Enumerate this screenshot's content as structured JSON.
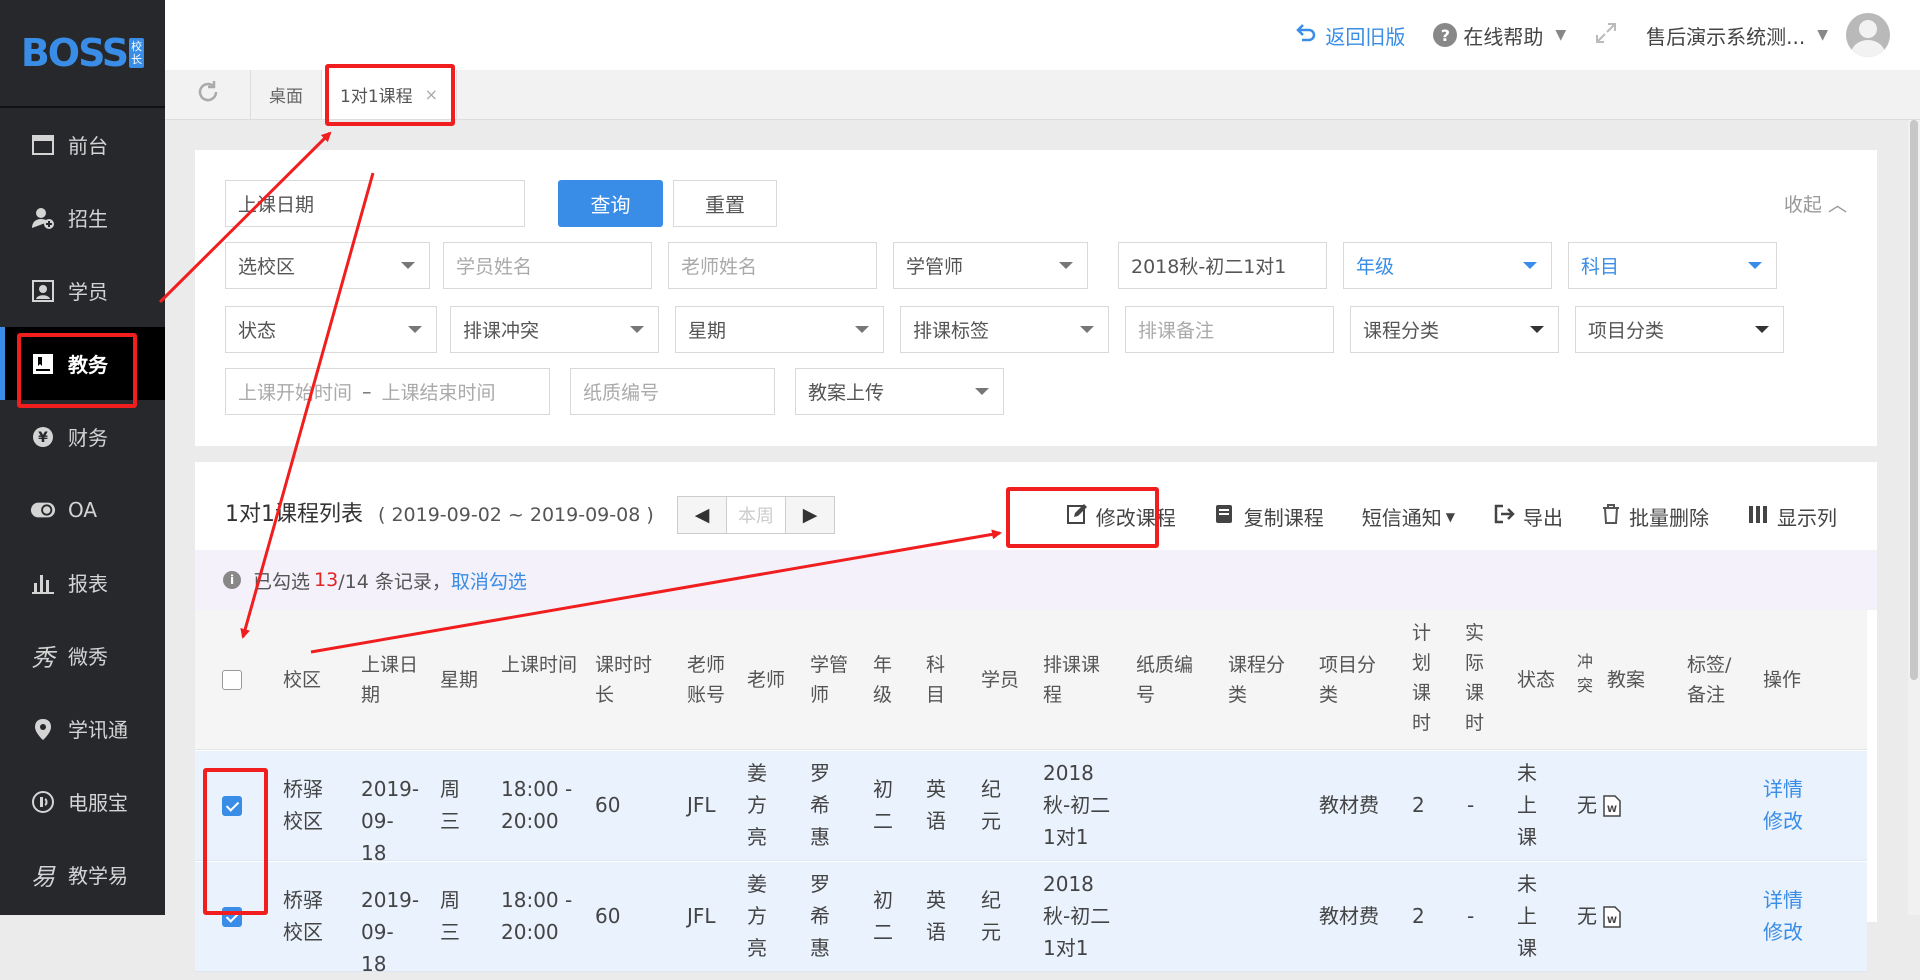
{
  "sidebar": {
    "logo_text": "BOSS",
    "logo_badge": "校长",
    "items": [
      {
        "label": "前台",
        "icon": "calendar-icon"
      },
      {
        "label": "招生",
        "icon": "add-user-icon"
      },
      {
        "label": "学员",
        "icon": "id-card-icon"
      },
      {
        "label": "教务",
        "icon": "book-icon"
      },
      {
        "label": "财务",
        "icon": "yen-icon"
      },
      {
        "label": "OA",
        "icon": "toggle-icon"
      },
      {
        "label": "报表",
        "icon": "bar-chart-icon"
      },
      {
        "label": "微秀",
        "icon": "xiu-icon"
      },
      {
        "label": "学讯通",
        "icon": "location-icon"
      },
      {
        "label": "电服宝",
        "icon": "phone-icon"
      },
      {
        "label": "教学易",
        "icon": "teach-icon"
      }
    ]
  },
  "topbar": {
    "back_old": "返回旧版",
    "help": "在线帮助",
    "user": "售后演示系统测..."
  },
  "tabs": [
    {
      "label": "桌面"
    },
    {
      "label": "1对1课程",
      "close": "×"
    }
  ],
  "filter": {
    "date_field": "上课日期",
    "query": "查询",
    "reset": "重置",
    "collapse": "收起",
    "campus": "选校区",
    "student_name": "学员姓名",
    "teacher_name": "老师姓名",
    "manager": "学管师",
    "course_name": "2018秋-初二1对1",
    "grade": "年级",
    "subject": "科目",
    "status": "状态",
    "conflict": "排课冲突",
    "weekday": "星期",
    "tag": "排课标签",
    "remark": "排课备注",
    "course_cat": "课程分类",
    "project_cat": "项目分类",
    "start_time": "上课开始时间",
    "dash": "–",
    "end_time": "上课结束时间",
    "paper_no": "纸质编号",
    "plan_upload": "教案上传"
  },
  "list": {
    "title": "1对1课程列表",
    "range": "( 2019-09-02 ~ 2019-09-08 )",
    "prev": "◀",
    "this_week": "本周",
    "next": "▶",
    "tools": {
      "edit": "修改课程",
      "copy": "复制课程",
      "sms": "短信通知",
      "export": "导出",
      "batch_delete": "批量删除",
      "columns": "显示列"
    },
    "info": {
      "prefix": "已勾选",
      "selected": "13",
      "total": "/14 条记录，",
      "cancel": "取消勾选"
    },
    "headers": {
      "campus": "校区",
      "date": "上课日期",
      "week": "星期",
      "time": "上课时间",
      "duration": "课时时长",
      "teacher_acct": "老师账号",
      "teacher": "老师",
      "manager": "学管师",
      "grade": "年级",
      "subject": "科目",
      "student": "学员",
      "course": "排课课程",
      "paper": "纸质编号",
      "course_cat": "课程分类",
      "project_cat": "项目分类",
      "plan_hours": "计划课时",
      "actual_hours": "实际课时",
      "status": "状态",
      "conflict": "冲突",
      "plan": "教案",
      "tag": "标签/备注",
      "op": "操作"
    },
    "rows": [
      {
        "checked": true,
        "campus": "桥驿校区",
        "date": "2019-09-18",
        "week": "周三",
        "time": "18:00 - 20:00",
        "duration": "60",
        "teacher_acct": "JFL",
        "teacher": "姜方亮",
        "manager": "罗希惠",
        "grade": "初二",
        "subject": "英语",
        "student": "纪元",
        "course": "2018秋-初二1对1",
        "project_cat": "教材费",
        "plan_hours": "2",
        "actual_hours": "-",
        "status": "未上课",
        "conflict": "无",
        "detail": "详情",
        "edit": "修改"
      },
      {
        "checked": true,
        "campus": "桥驿校区",
        "date": "2019-09-18",
        "week": "周三",
        "time": "18:00 - 20:00",
        "duration": "60",
        "teacher_acct": "JFL",
        "teacher": "姜方亮",
        "manager": "罗希惠",
        "grade": "初二",
        "subject": "英语",
        "student": "纪元",
        "course": "2018秋-初二1对1",
        "project_cat": "教材费",
        "plan_hours": "2",
        "actual_hours": "-",
        "status": "未上课",
        "conflict": "无",
        "detail": "详情",
        "edit": "修改"
      }
    ]
  },
  "colors": {
    "accent": "#3a8de6",
    "annotation": "#f01e1e",
    "sidebar_bg": "#26282c"
  }
}
